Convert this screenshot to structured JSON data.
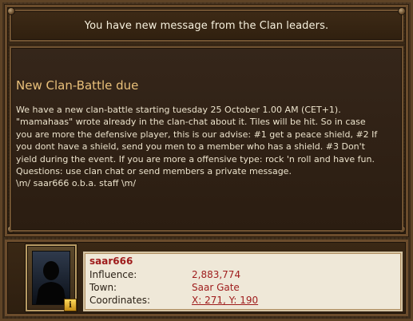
{
  "header": {
    "title": "You have new message from the Clan leaders."
  },
  "message": {
    "subject": "New Clan-Battle due",
    "body_lines": [
      "We have a new clan-battle starting tuesday 25 October 1.00 AM (CET+1).",
      "\"mamahaas\" wrote already in the clan-chat about it. Tiles will be hit. So in case",
      "you are more the defensive player, this is our advise: #1 get a peace shield, #2 If",
      "you dont have a shield, send you men to a member who has a shield. #3 Don't",
      "yield during the event. If you are more a offensive type: rock 'n roll and have fun.",
      "Questions: use clan chat or send members a private message.",
      "\\m/ saar666 o.b.a. staff \\m/"
    ]
  },
  "profile": {
    "name": "saar666",
    "influence_label": "Influence:",
    "influence_value": "2,883,774",
    "town_label": "Town:",
    "town_value": "Saar Gate",
    "coordinates_label": "Coordinates:",
    "coordinates_value": "X: 271, Y: 190"
  },
  "icons": {
    "info_badge": "i"
  },
  "colors": {
    "background": "#3b2a18",
    "accent_text": "#9e1b1b",
    "subject_color": "#e9c07a",
    "card_background": "#efe8d8"
  }
}
